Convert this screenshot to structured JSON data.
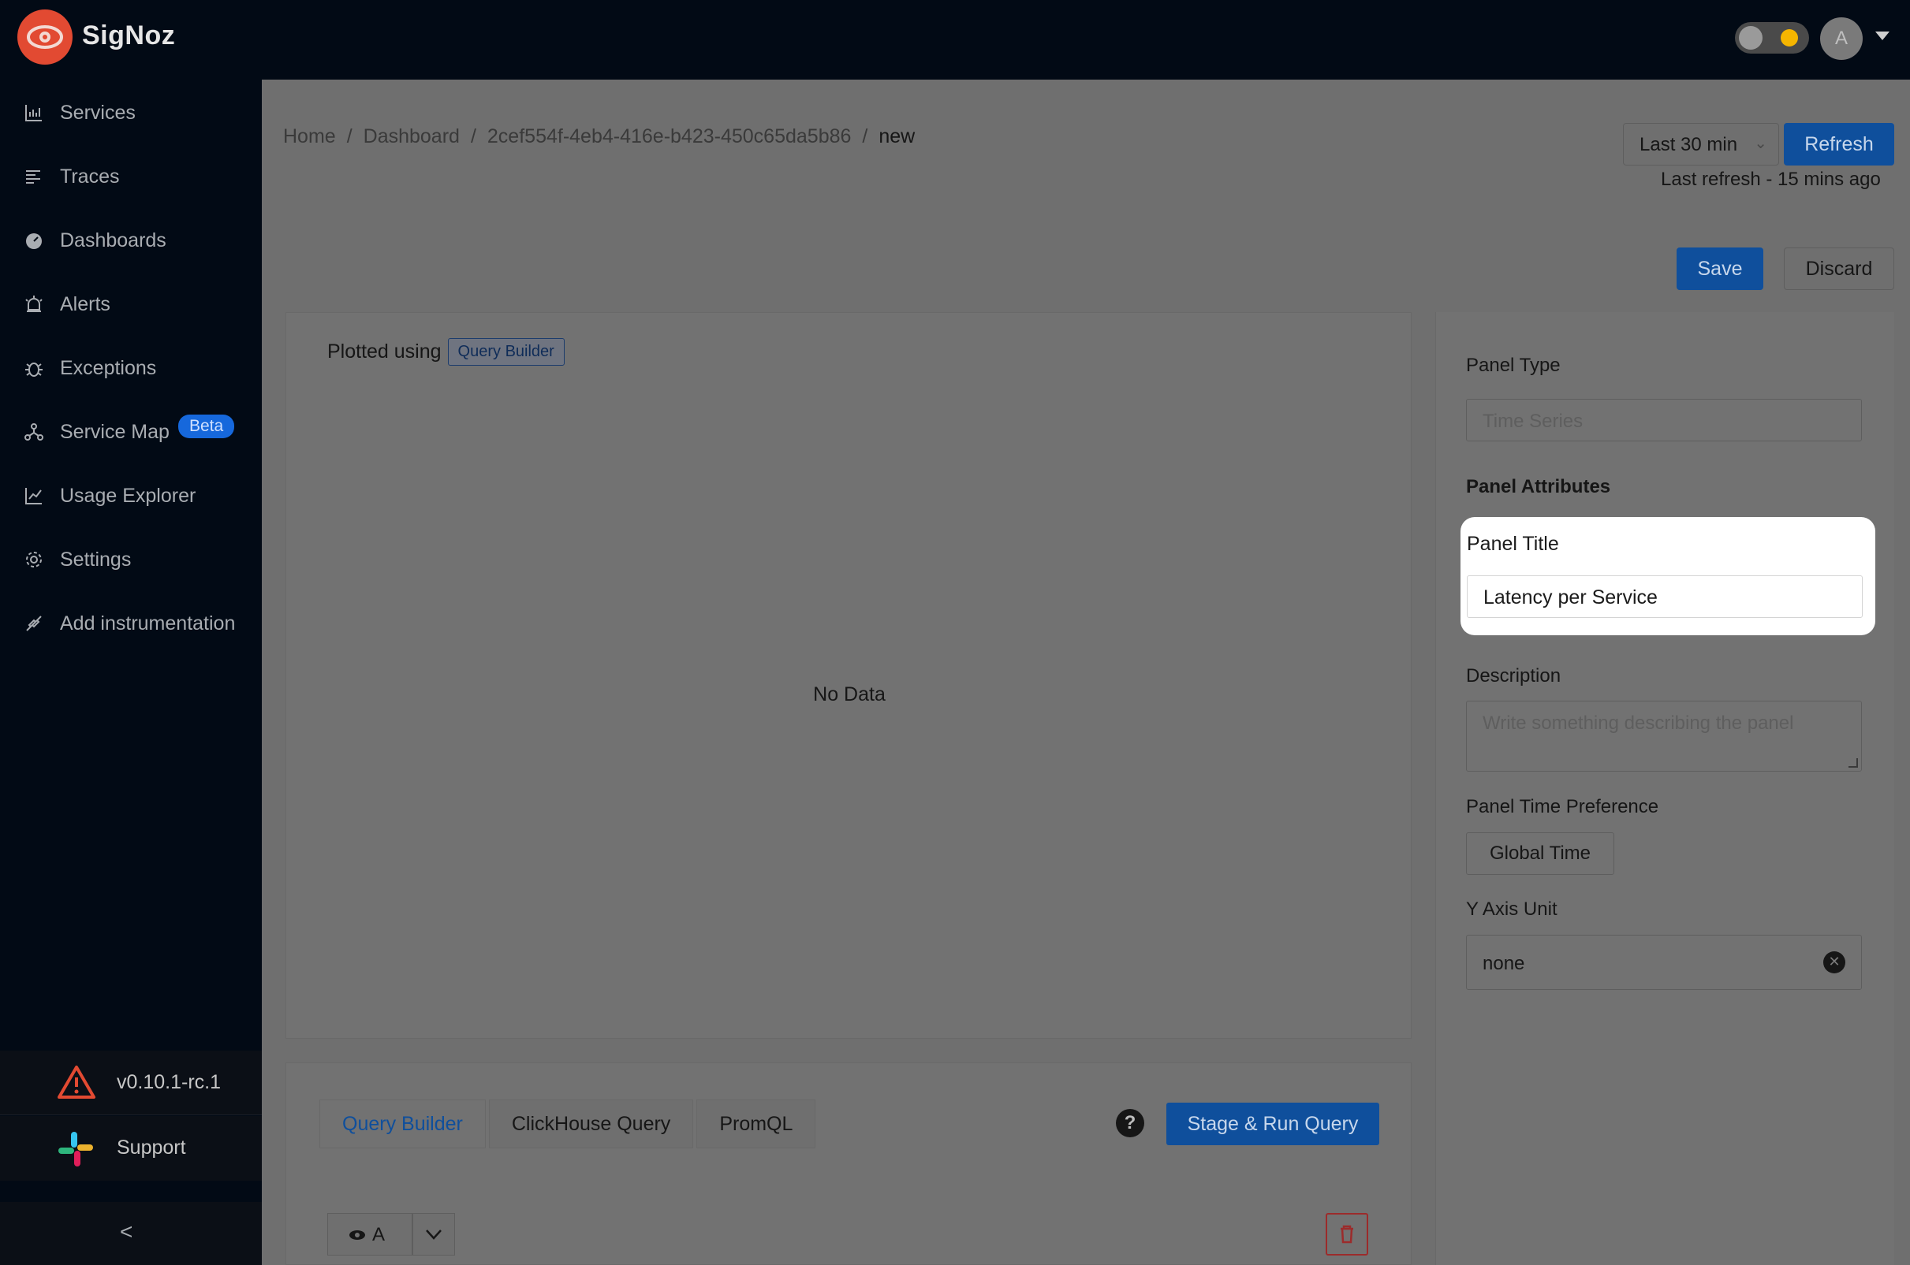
{
  "header": {
    "brand": "SigNoz",
    "avatar_initial": "A"
  },
  "sidebar": {
    "items": [
      {
        "label": "Services",
        "icon": "bar-chart-icon"
      },
      {
        "label": "Traces",
        "icon": "align-left-icon"
      },
      {
        "label": "Dashboards",
        "icon": "dashboard-icon"
      },
      {
        "label": "Alerts",
        "icon": "alarm-icon"
      },
      {
        "label": "Exceptions",
        "icon": "bug-icon"
      },
      {
        "label": "Service Map",
        "icon": "deployment-icon",
        "badge": "Beta"
      },
      {
        "label": "Usage Explorer",
        "icon": "line-chart-icon"
      },
      {
        "label": "Settings",
        "icon": "gear-icon"
      },
      {
        "label": "Add instrumentation",
        "icon": "api-icon"
      }
    ],
    "version": "v0.10.1-rc.1",
    "support": "Support",
    "collapse_glyph": "<"
  },
  "breadcrumb": {
    "home": "Home",
    "dashboard": "Dashboard",
    "id": "2cef554f-4eb4-416e-b423-450c65da5b86",
    "current": "new",
    "sep": "/"
  },
  "toolbar": {
    "time_range": "Last 30 min",
    "refresh_label": "Refresh",
    "last_refresh": "Last refresh - 15 mins ago",
    "save_label": "Save",
    "discard_label": "Discard"
  },
  "graph": {
    "plotted_using": "Plotted using",
    "plotted_tag": "Query Builder",
    "empty_text": "No Data"
  },
  "panel_settings": {
    "panel_type_label": "Panel Type",
    "panel_type_value": "Time Series",
    "attributes_heading": "Panel Attributes",
    "title_label": "Panel Title",
    "title_value": "Latency per Service",
    "description_label": "Description",
    "description_placeholder": "Write something describing the  panel",
    "time_pref_label": "Panel Time Preference",
    "time_pref_value": "Global Time",
    "y_axis_label": "Y Axis Unit",
    "y_axis_value": "none"
  },
  "query": {
    "tabs": [
      "Query Builder",
      "ClickHouse Query",
      "PromQL"
    ],
    "help": "?",
    "run_label": "Stage & Run Query",
    "query_name": "A"
  },
  "colors": {
    "brand_red": "#e24a32",
    "primary_blue": "#1668dc",
    "sidebar_bg": "#020a15"
  }
}
